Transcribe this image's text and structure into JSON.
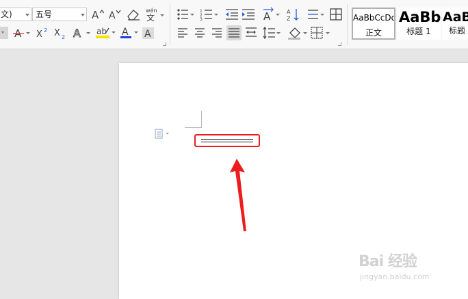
{
  "toolbar": {
    "font_name": "文)",
    "font_size": "五号",
    "phonetic_guide_glyph": "wén\n文",
    "text_effect_glyph": "A",
    "char_shading_glyph": "A",
    "font_color": "#1e3cd8",
    "highlight_color": "#f5e300"
  },
  "styles": [
    {
      "sample": "AaBbCcDd",
      "name": "正文"
    },
    {
      "sample": "AaBb",
      "name": "标题 1"
    },
    {
      "sample": "AaB",
      "name": "标题"
    }
  ],
  "document": {
    "content": "double horizontal line",
    "annotation_color": "#ee1c1c"
  },
  "watermark": {
    "brand": "Bai 经验",
    "url": "jingyan.baidu.com"
  }
}
